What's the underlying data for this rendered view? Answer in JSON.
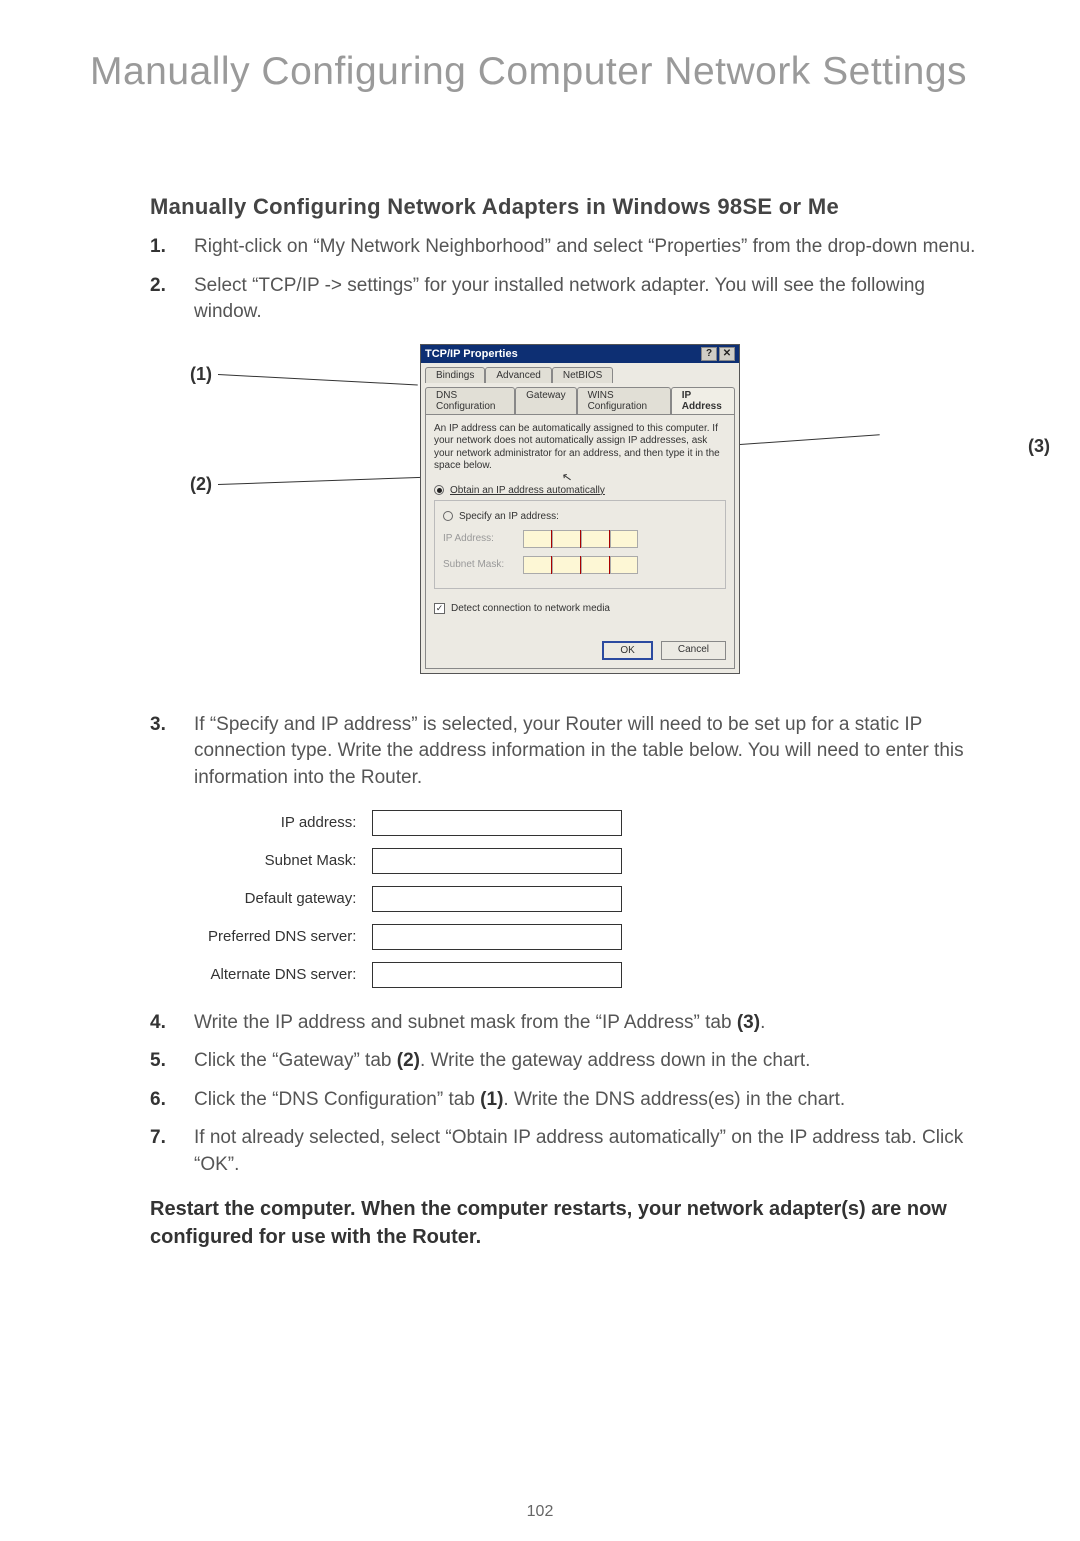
{
  "page_title": "Manually Configuring Computer Network Settings",
  "section_title": "Manually Configuring Network Adapters in Windows 98SE or Me",
  "steps": {
    "s1": {
      "num": "1.",
      "text": "Right-click on “My Network Neighborhood” and select “Properties” from the drop-down menu."
    },
    "s2": {
      "num": "2.",
      "text": "Select “TCP/IP -> settings” for your installed network adapter. You will see the following window."
    },
    "s3": {
      "num": "3.",
      "text": "If “Specify and IP address” is selected, your Router will need to be set up for a static IP connection type. Write the address information in the table below. You will need to enter this information into the Router."
    },
    "s4": {
      "num": "4.",
      "pre": "Write the IP address and subnet mask from the “IP Address” tab ",
      "ref": "(3)",
      "post": "."
    },
    "s5": {
      "num": "5.",
      "pre": "Click the “Gateway” tab ",
      "ref": "(2)",
      "post": ". Write the gateway address down in the chart."
    },
    "s6": {
      "num": "6.",
      "pre": "Click the “DNS Configuration” tab ",
      "ref": "(1)",
      "post": ". Write the DNS address(es) in the chart."
    },
    "s7": {
      "num": "7.",
      "text": "If not already selected, select “Obtain IP address automatically” on the IP address tab. Click “OK”."
    }
  },
  "callouts": {
    "c1": "(1)",
    "c2": "(2)",
    "c3": "(3)"
  },
  "dialog": {
    "title": "TCP/IP Properties",
    "help": "?",
    "close": "✕",
    "tabs_top": {
      "bindings": "Bindings",
      "advanced": "Advanced",
      "netbios": "NetBIOS"
    },
    "tabs_bottom": {
      "dns": "DNS Configuration",
      "gateway": "Gateway",
      "wins": "WINS Configuration",
      "ip": "IP Address"
    },
    "info": "An IP address can be automatically assigned to this computer. If your network does not automatically assign IP addresses, ask your network administrator for an address, and then type it in the space below.",
    "opt_auto": "Obtain an IP address automatically",
    "opt_specify": "Specify an IP address:",
    "ip_label": "IP Address:",
    "subnet_label": "Subnet Mask:",
    "detect": "Detect connection to network media",
    "ok": "OK",
    "cancel": "Cancel"
  },
  "form": {
    "ip": "IP address:",
    "subnet": "Subnet Mask:",
    "gateway": "Default gateway:",
    "pref_dns": "Preferred DNS server:",
    "alt_dns": "Alternate DNS server:"
  },
  "restart_note": "Restart the computer. When the computer restarts, your network adapter(s) are now configured for use with the Router.",
  "page_number": "102"
}
